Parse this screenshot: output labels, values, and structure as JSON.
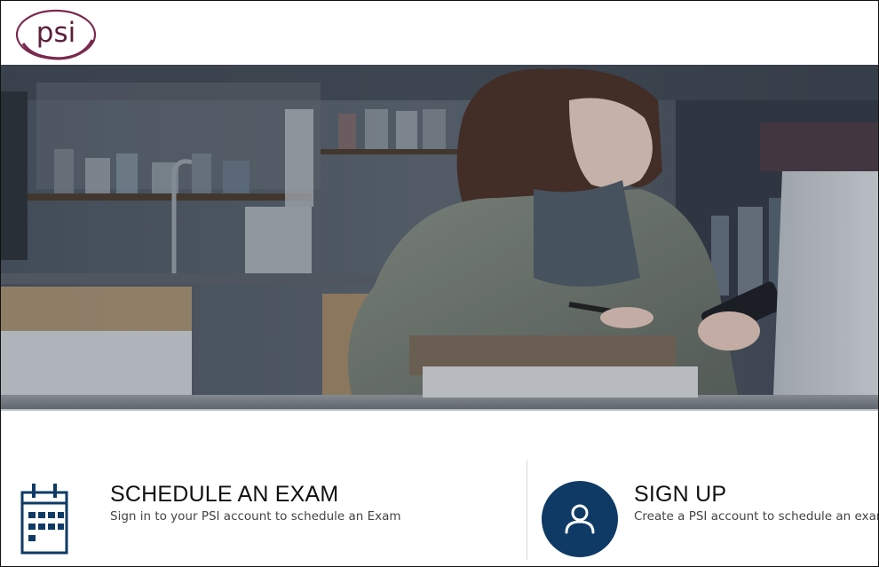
{
  "header": {
    "logo_text": "psi",
    "logo_ring_color": "#7a2a4f"
  },
  "hero": {
    "description_icon": "hero-photo"
  },
  "actions": {
    "schedule": {
      "icon": "calendar-icon",
      "title": "SCHEDULE AN EXAM",
      "description": "Sign in to your PSI account to schedule an Exam"
    },
    "signup": {
      "icon": "user-icon",
      "title": "SIGN UP",
      "description": "Create a PSI account to schedule an exam"
    }
  },
  "colors": {
    "brand_navy": "#0f3a66",
    "brand_maroon": "#7a2a4f"
  }
}
